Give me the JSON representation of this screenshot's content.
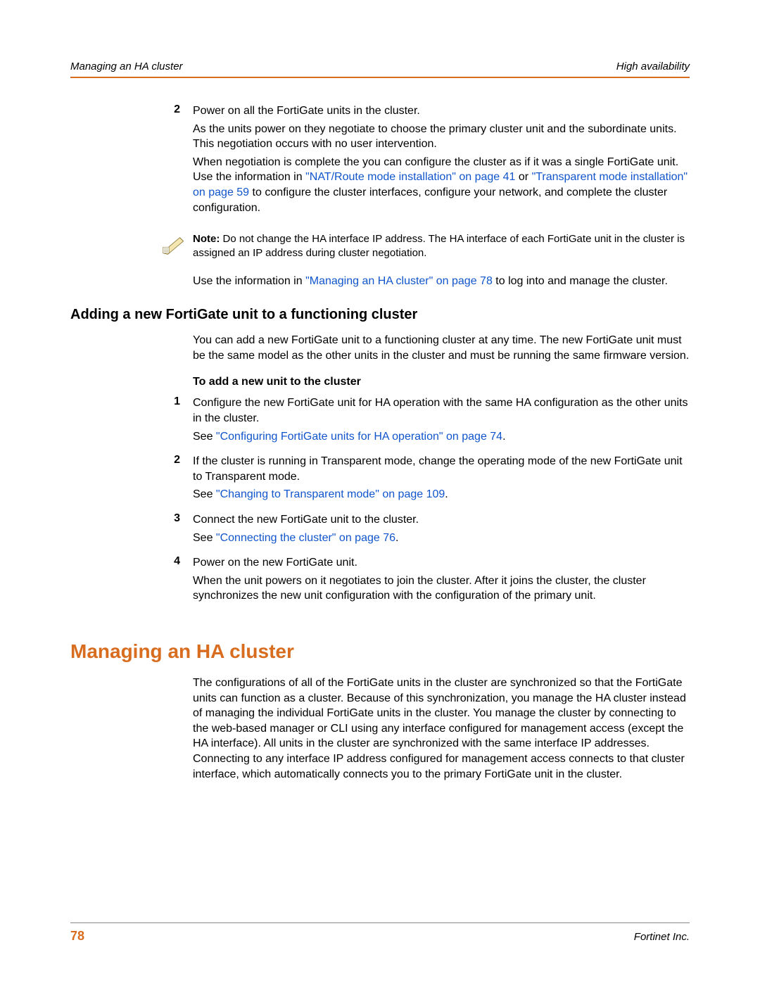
{
  "header": {
    "left": "Managing an HA cluster",
    "right": "High availability"
  },
  "step2": {
    "num": "2",
    "p1": "Power on all the FortiGate units in the cluster.",
    "p2": "As the units power on they negotiate to choose the primary cluster unit and the subordinate units. This negotiation occurs with no user intervention.",
    "p3a": "When negotiation is complete the you can configure the cluster as if it was a single FortiGate unit. Use the information in ",
    "link1": "\"NAT/Route mode installation\" on page 41",
    "p3b": " or ",
    "link2": "\"Transparent mode installation\" on page 59",
    "p3c": " to configure the cluster interfaces, configure your network, and complete the cluster configuration."
  },
  "note": {
    "label": "Note:",
    "text": " Do not change the HA interface IP address. The HA interface of each FortiGate unit in the cluster is assigned an IP address during cluster negotiation."
  },
  "afterNote": {
    "a": "Use the information in ",
    "link": "\"Managing an HA cluster\" on page 78",
    "b": " to log into and manage the cluster."
  },
  "h2": "Adding a new FortiGate unit to a functioning cluster",
  "introPara": "You can add a new FortiGate unit to a functioning cluster at any time. The new FortiGate unit must be the same model as the other units in the cluster and must be running the same firmware version.",
  "h3": "To add a new unit to the cluster",
  "addSteps": [
    {
      "num": "1",
      "p1": "Configure the new FortiGate unit for HA operation with the same HA configuration as the other units in the cluster.",
      "see": "See ",
      "link": "\"Configuring FortiGate units for HA operation\" on page 74",
      "tail": "."
    },
    {
      "num": "2",
      "p1": "If the cluster is running in Transparent mode, change the operating mode of the new FortiGate unit to Transparent mode.",
      "see": "See ",
      "link": "\"Changing to Transparent mode\" on page 109",
      "tail": "."
    },
    {
      "num": "3",
      "p1": "Connect the new FortiGate unit to the cluster.",
      "see": "See ",
      "link": "\"Connecting the cluster\" on page 76",
      "tail": "."
    },
    {
      "num": "4",
      "p1": "Power on the new FortiGate unit.",
      "p2": "When the unit powers on it negotiates to join the cluster. After it joins the cluster, the cluster synchronizes the new unit configuration with the configuration of the primary unit."
    }
  ],
  "sectionTitle": "Managing an HA cluster",
  "sectionBody": "The configurations of all of the FortiGate units in the cluster are synchronized so that the FortiGate units can function as a cluster. Because of this synchronization, you manage the HA cluster instead of managing the individual FortiGate units in the cluster. You manage the cluster by connecting to the web-based manager or CLI using any interface configured for management access (except the HA interface). All units in the cluster are synchronized with the same interface IP addresses. Connecting to any interface IP address configured for management access connects to that cluster interface, which automatically connects you to the primary FortiGate unit in the cluster.",
  "footer": {
    "page": "78",
    "right": "Fortinet Inc."
  }
}
